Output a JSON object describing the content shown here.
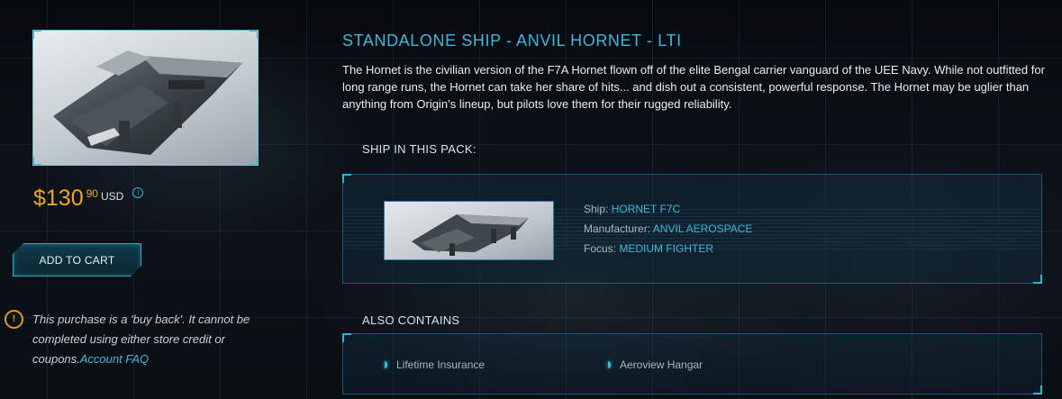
{
  "product": {
    "title": "STANDALONE SHIP - ANVIL HORNET - LTI",
    "description": "The Hornet is the civilian version of the F7A Hornet flown off of the elite Bengal carrier vanguard of the UEE Navy. While not outfitted for long range runs, the Hornet can take her share of hits... and dish out a consistent, powerful response. The Hornet may be uglier than anything from Origin’s lineup, but pilots love them for their rugged reliability.",
    "image_icon": "ship-render"
  },
  "price": {
    "main": "$130",
    "cents": "90",
    "currency": "USD",
    "info_icon": "info-icon"
  },
  "cart": {
    "add_label": "ADD TO CART"
  },
  "notice": {
    "icon": "warning-icon",
    "text": "This purchase is a 'buy back'. It cannot be completed using either store credit or coupons.",
    "link_label": "Account FAQ"
  },
  "ship_section": {
    "heading": "SHIP IN THIS PACK:",
    "ship_label": "Ship:",
    "ship_value": "HORNET F7C",
    "manufacturer_label": "Manufacturer:",
    "manufacturer_value": "ANVIL AEROSPACE",
    "focus_label": "Focus:",
    "focus_value": "MEDIUM FIGHTER"
  },
  "also_contains": {
    "heading": "ALSO CONTAINS",
    "items": [
      "Lifetime Insurance",
      "Aeroview Hangar"
    ]
  },
  "colors": {
    "accent": "#3ab9dc",
    "price": "#f0a51e",
    "warning": "#e09a1b",
    "background": "#0a0f14"
  }
}
